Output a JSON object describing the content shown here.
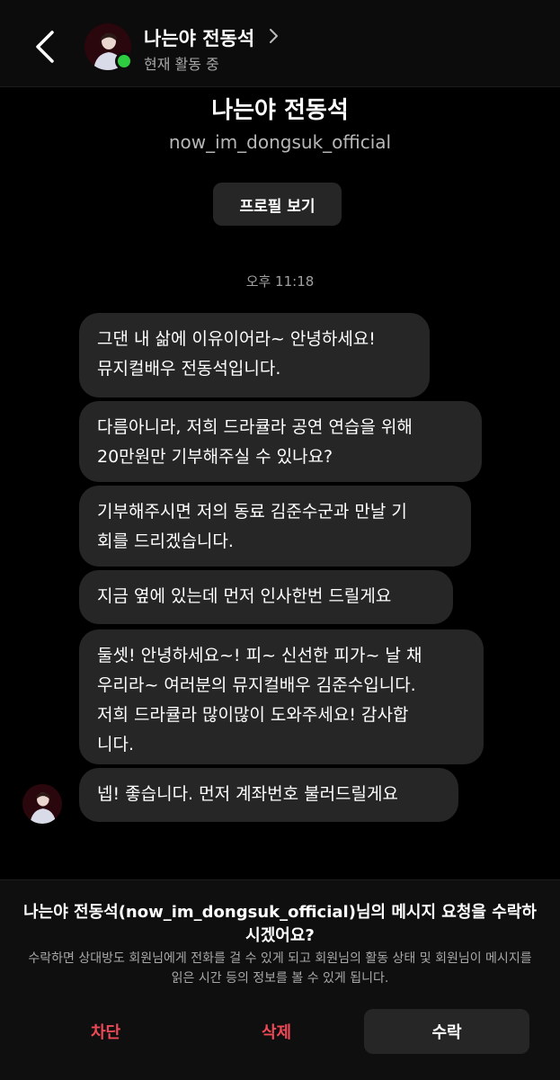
{
  "header": {
    "name": "나는야 전동석",
    "status": "현재 활동 중"
  },
  "profile": {
    "name": "나는야 전동석",
    "handle": "now_im_dongsuk_official",
    "view_profile_label": "프로필 보기"
  },
  "chat": {
    "timestamp": "오후 11:18",
    "messages": [
      "그댄 내 삶에 이유이어라~ 안녕하세요!\n뮤지컬배우 전동석입니다.",
      "다름아니라, 저희 드라큘라 공연 연습을 위해\n20만원만 기부해주실 수 있나요?",
      "기부해주시면 저의 동료 김준수군과 만날 기\n회를 드리겠습니다.",
      "지금 옆에 있는데 먼저 인사한번 드릴게요",
      "둘셋! 안녕하세요~! 피~ 신선한 피가~ 날 채\n우리라~ 여러분의 뮤지컬배우 김준수입니다.\n저희 드라큘라 많이많이 도와주세요! 감사합\n니다.",
      "넵! 좋습니다. 먼저 계좌번호 불러드릴게요"
    ]
  },
  "request": {
    "title": "나는야 전동석(now_im_dongsuk_official)님의 메시지 요청을 수락하시겠어요?",
    "description": "수락하면 상대방도 회원님에게 전화를 걸 수 있게 되고 회원님의 활동 상태 및 회원님이 메시지를 읽은 시간 등의 정보를 볼 수 있게 됩니다.",
    "block_label": "차단",
    "delete_label": "삭제",
    "accept_label": "수락"
  },
  "colors": {
    "danger": "#ed4956",
    "online": "#2ecc40",
    "bubble": "#262626"
  }
}
